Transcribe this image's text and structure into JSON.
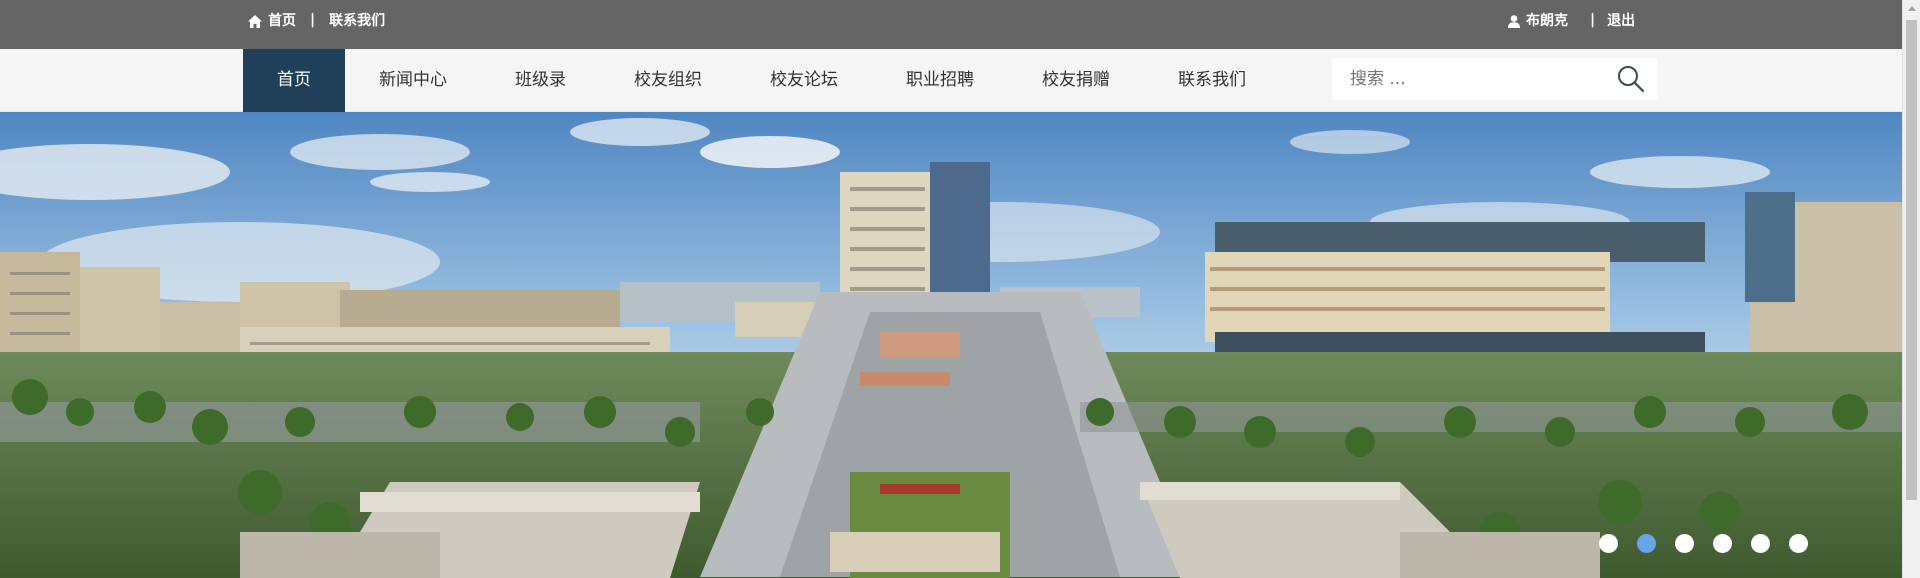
{
  "topbar": {
    "home_label": "首页",
    "separator": "|",
    "contact_label": "联系我们",
    "username": "布朗克",
    "logout_label": "退出"
  },
  "nav": {
    "items": [
      {
        "label": "首页",
        "active": true
      },
      {
        "label": "新闻中心",
        "active": false
      },
      {
        "label": "班级录",
        "active": false
      },
      {
        "label": "校友组织",
        "active": false
      },
      {
        "label": "校友论坛",
        "active": false
      },
      {
        "label": "职业招聘",
        "active": false
      },
      {
        "label": "校友捐赠",
        "active": false
      },
      {
        "label": "联系我们",
        "active": false
      }
    ],
    "search_placeholder": "搜索 ..."
  },
  "banner": {
    "slide_count": 6,
    "active_slide": 2
  },
  "colors": {
    "topbar_bg": "#656565",
    "nav_bg": "#f5f5f5",
    "nav_active_bg": "#1f4058",
    "dot_active": "#6aa4e8"
  },
  "icons": {
    "home": "home-icon",
    "user": "user-icon",
    "search": "search-icon"
  }
}
